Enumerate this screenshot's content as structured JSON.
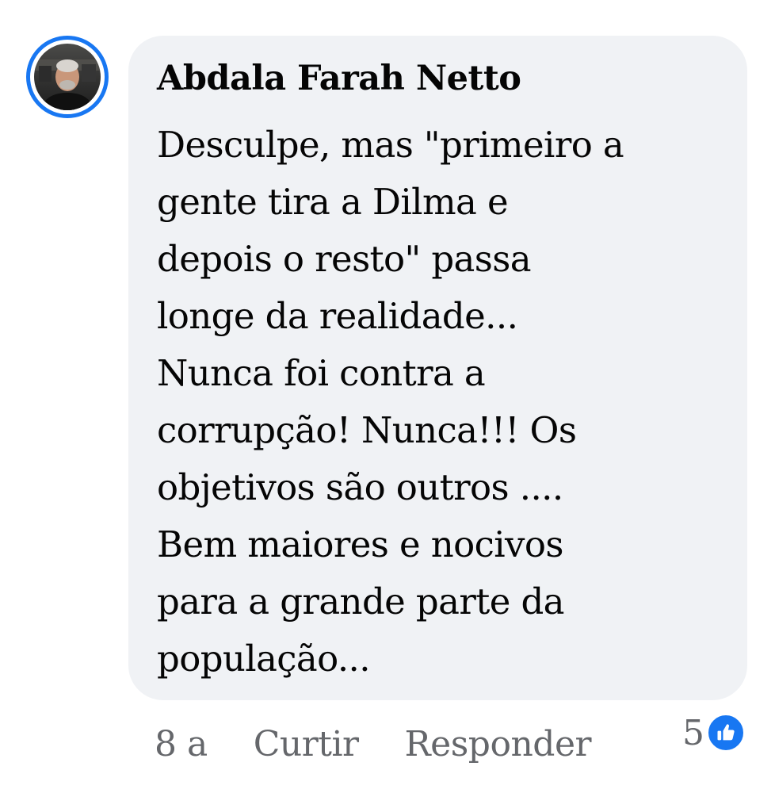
{
  "comment": {
    "author": "Abdala Farah Netto",
    "text": "Desculpe, mas \"primeiro a\ngente tira a Dilma e\ndepois o resto\" passa\nlonge da realidade...\nNunca foi contra a\ncorrupção! Nunca!!! Os\nobjetivos são outros ....\nBem maiores e nocivos\npara a grande parte da\npopulação...",
    "avatar_icon": "profile-photo",
    "avatar_ring_color": "#1877f2",
    "bubble_color": "#f0f2f5"
  },
  "actions": {
    "time": "8 a",
    "like_label": "Curtir",
    "reply_label": "Responder"
  },
  "reactions": {
    "count": "5",
    "icon": "thumbs-up-icon",
    "color": "#1877f2"
  }
}
